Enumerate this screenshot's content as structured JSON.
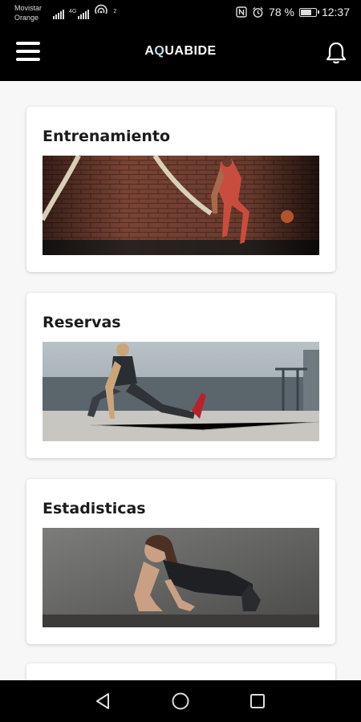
{
  "status_bar": {
    "carrier_line1": "Movistar",
    "carrier_line2": "Orange",
    "network_tag": "4G",
    "hotspot_tag": "2",
    "battery_text": "78 %",
    "battery_level": 0.78,
    "time": "12:37"
  },
  "app_bar": {
    "logo_part1": "A",
    "logo_q": "Q",
    "logo_part2": "UABIDE"
  },
  "cards": [
    {
      "title": "Entrenamiento",
      "image": "battle-ropes-workout"
    },
    {
      "title": "Reservas",
      "image": "stretching-rooftop"
    },
    {
      "title": "Estadisticas",
      "image": "plank-exercise"
    }
  ],
  "icons": {
    "menu": "hamburger-menu-icon",
    "notifications": "bell-icon",
    "back": "triangle-back-icon",
    "home": "circle-home-icon",
    "recents": "square-recents-icon"
  },
  "colors": {
    "bar_background": "#000000",
    "page_background": "#f7f7f7",
    "logo_q_accent": "#b9e4ef"
  }
}
